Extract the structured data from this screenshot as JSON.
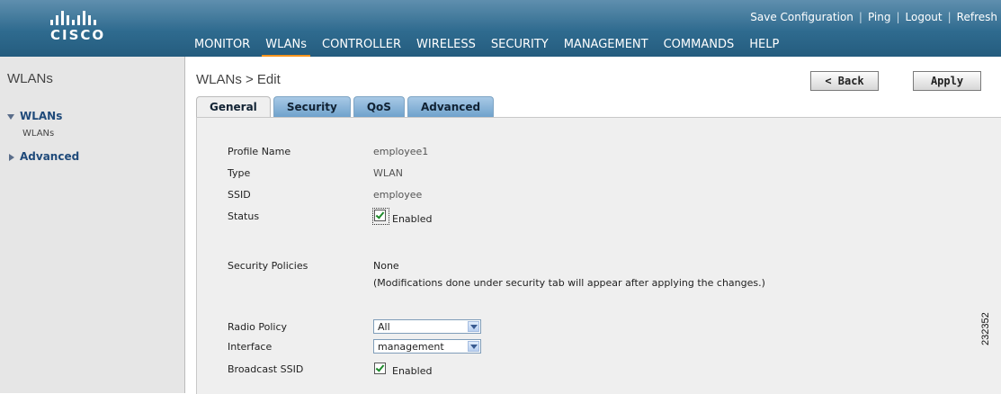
{
  "header": {
    "brand": "CISCO",
    "top_links": [
      "Save Configuration",
      "Ping",
      "Logout",
      "Refresh"
    ],
    "nav": [
      "MONITOR",
      "WLANs",
      "CONTROLLER",
      "WIRELESS",
      "SECURITY",
      "MANAGEMENT",
      "COMMANDS",
      "HELP"
    ],
    "active_nav": "WLANs"
  },
  "sidebar": {
    "title": "WLANs",
    "items": [
      {
        "label": "WLANs",
        "sub": "WLANs"
      },
      {
        "label": "Advanced"
      }
    ]
  },
  "main": {
    "title": "WLANs > Edit",
    "back_label": "< Back",
    "apply_label": "Apply",
    "tabs": [
      "General",
      "Security",
      "QoS",
      "Advanced"
    ],
    "active_tab": "General",
    "fields": {
      "profile_name_label": "Profile Name",
      "profile_name_value": "employee1",
      "type_label": "Type",
      "type_value": "WLAN",
      "ssid_label": "SSID",
      "ssid_value": "employee",
      "status_label": "Status",
      "status_text": "Enabled",
      "status_checked": true,
      "security_policies_label": "Security Policies",
      "security_policies_value": "None",
      "security_note": "(Modifications done under security tab will appear after applying the changes.)",
      "radio_policy_label": "Radio Policy",
      "radio_policy_value": "All",
      "interface_label": "Interface",
      "interface_value": "management",
      "broadcast_ssid_label": "Broadcast SSID",
      "broadcast_ssid_text": "Enabled",
      "broadcast_ssid_checked": true
    }
  },
  "figure_number": "232352",
  "colors": {
    "header": "#2f6b8f",
    "nav_active_underline": "#f6941d",
    "tab_blue": "#6fa2cc",
    "panel_bg": "#efefef",
    "sidebar_bg": "#e6e6e6"
  }
}
